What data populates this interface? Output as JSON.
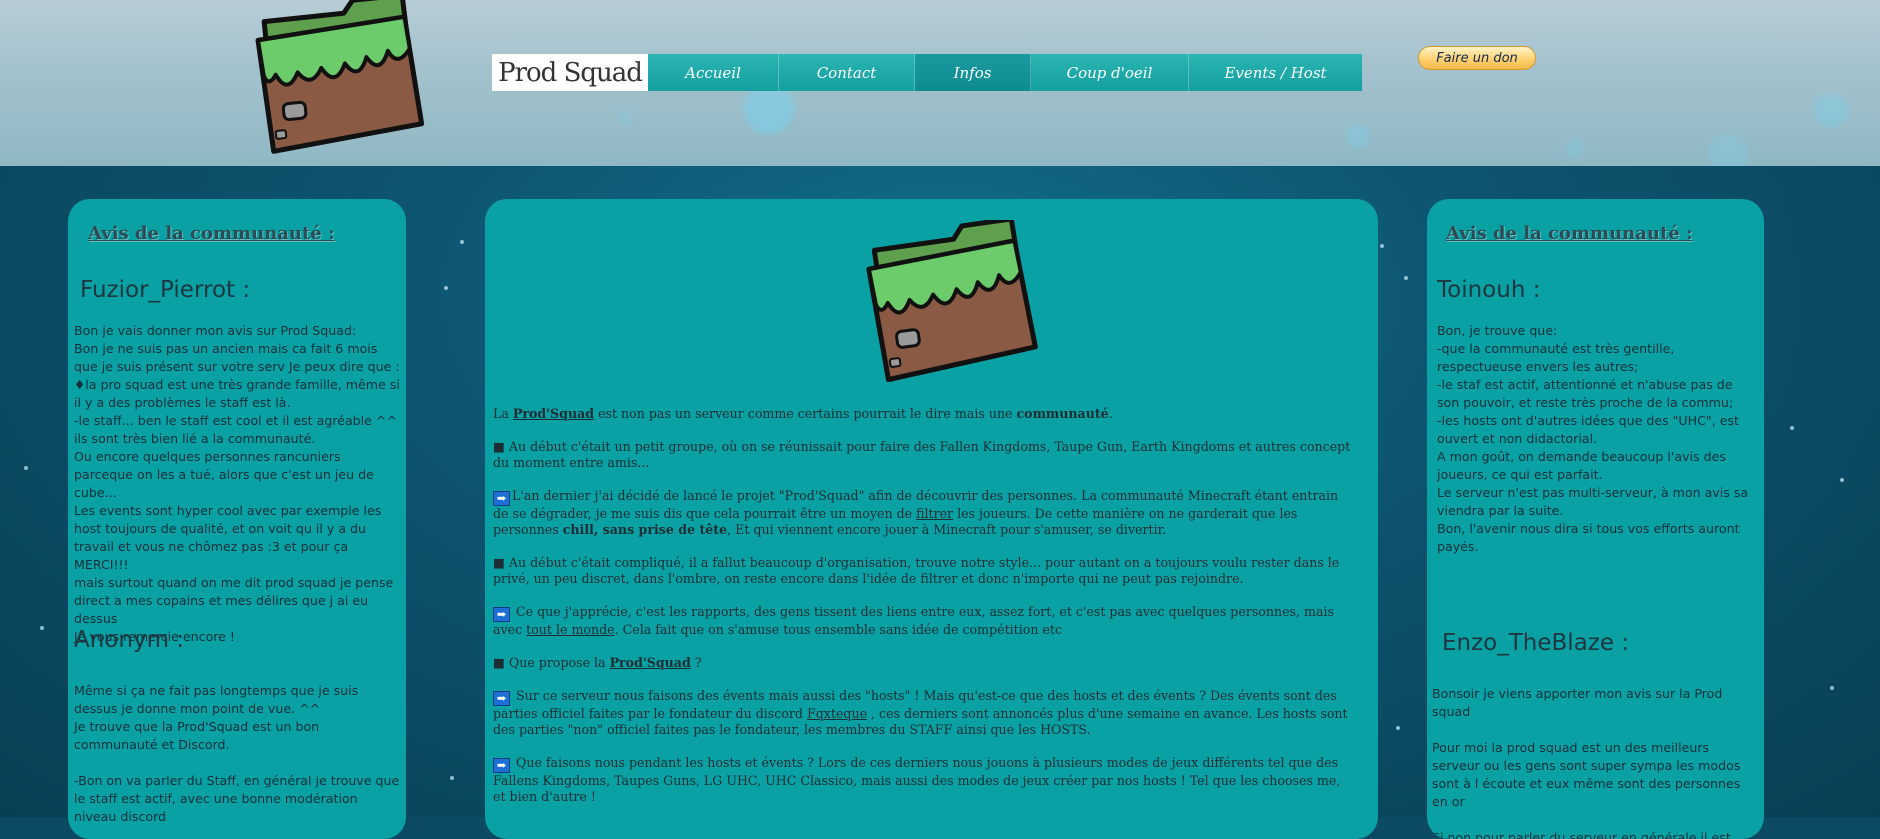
{
  "header": {
    "brand": "Prod Squad",
    "nav": [
      "Accueil",
      "Contact",
      "Infos",
      "Coup d'oeil",
      "Events / Host"
    ],
    "active_nav": "Infos",
    "donate_label": "Faire un don"
  },
  "left_panel": {
    "title": "Avis de la communauté :",
    "reviews": [
      {
        "name": "Fuzior_Pierrot :",
        "text": "Bon je vais donner mon avis sur Prod Squad:\nBon je ne suis pas un ancien mais ca fait 6 mois que je suis présent sur votre serv Je peux dire que :\n♦la pro squad est une très grande famille, même si il y a des problèmes le staff est là.\n-le staff... ben le staff est cool et il est agréable ^^ ils sont très bien lié a la communauté.\nOu encore quelques personnes rancuniers parceque on les a tué, alors que c'est un jeu de cube...\nLes events sont hyper cool avec par exemple les host toujours de qualité, et on voit qu il y a du travail et vous ne chômez pas :3 et pour ça MERCI!!!\nmais surtout quand on me dit prod squad je pense direct a mes copains et mes délires que j ai eu dessus\nJe vous remercie encore !"
      },
      {
        "name": "Anonym :",
        "text": "Même si ça ne fait pas longtemps que je suis dessus je donne mon point de vue. ^^\nJe trouve que la Prod'Squad est un bon communauté et Discord.\n\n-Bon on va parler du Staff, en général je trouve que le staff est actif, avec une bonne modération niveau discord"
      }
    ]
  },
  "right_panel": {
    "title": "Avis de la communauté :",
    "reviews": [
      {
        "name": "Toinouh :",
        "text": "Bon, je trouve que:\n-que la communauté est très gentille, respectueuse envers les autres;\n-le staf est actif, attentionné et n'abuse pas de son pouvoir, et reste très proche de la commu;\n-les hosts ont d'autres idées que des \"UHC\", est ouvert et non didactorial.\nA mon goût, on demande beaucoup l'avis des joueurs, ce qui est parfait.\nLe serveur n'est pas multi-serveur, à mon avis sa viendra par la suite.\nBon, l'avenir nous dira si tous vos efforts auront payés."
      },
      {
        "name": "Enzo_TheBlaze :",
        "text": "Bonsoir je viens apporter mon avis sur la Prod squad\n\nPour moi la prod squad est un des meilleurs serveur ou les gens  sont super sympa les modos sont à l écoute et eux même sont des personnes en or\n\nSi non pour parler du serveur en générale il est bien"
      }
    ]
  },
  "center": {
    "intro_a": "La ",
    "intro_link": "Prod'Squad",
    "intro_b": " est non pas un serveur comme certains pourrait le dire mais une ",
    "intro_bold": "communauté",
    "intro_c": ".",
    "p2": "■ Au début c'était un petit groupe, où on se réunissait pour faire des Fallen Kingdoms, Taupe Gun, Earth Kingdoms et autres concept du moment entre amis...",
    "p3_a": "L'an dernier j'ai décidé de lancé le projet \"Prod'Squad\" afin de découvrir des personnes. La communauté Minecraft étant entrain de se dégrader, je me suis dis que cela pourrait être un moyen de ",
    "p3_link": "filtrer",
    "p3_b": " les joueurs. De cette manière on ne garderait que les personnes ",
    "p3_bold": "chill, sans prise de tête",
    "p3_c": ", Et qui viennent encore jouer à Minecraft pour s'amuser, se divertir.",
    "p4": "■ Au début c'était compliqué, il a fallut beaucoup d'organisation, trouve notre style... pour autant on a toujours voulu rester dans le privé, un peu discret, dans l'ombre, on reste encore dans l'idée de filtrer et donc n'importe qui ne peut pas rejoindre.",
    "p5_a": " Ce que j'apprécie, c'est les rapports, des gens tissent des liens entre eux, assez fort, et c'est pas avec quelques personnes, mais avec ",
    "p5_link": "tout le monde",
    "p5_b": ". Cela fait que on s'amuse tous ensemble sans idée de compétition etc",
    "p6_a": "■ Que propose la ",
    "p6_link": "Prod'Squad",
    "p6_b": " ?",
    "p7_a": " Sur ce serveur nous faisons des évents mais aussi des \"hosts\" ! Mais qu'est-ce que des hosts et des évents ? Des évents sont des parties officiel faites par le fondateur du discord ",
    "p7_link": "Fqxteque",
    "p7_b": " , ces derniers sont annoncés plus d'une semaine en avance. Les hosts sont des parties \"non\" officiel faites pas le fondateur, les membres du STAFF ainsi que les HOSTS.",
    "p8": " Que faisons nous pendant les hosts et évents ? Lors de ces derniers nous jouons à plusieurs modes de jeux différents tel que des Fallens Kingdoms, Taupes Guns, LG UHC, UHC Classico, mais aussi des modes de jeux créer par nos hosts ! Tel que les chooses me, et bien d'autre !",
    "arrow_glyph": "➡"
  },
  "colors": {
    "panel": "#0aa1a4",
    "nav": "#15a0a0",
    "header_bg": "#a4c2cd",
    "page_bg": "#0b4a62"
  },
  "icons": [
    "grass-block-folder-icon",
    "arrow-right-icon"
  ]
}
